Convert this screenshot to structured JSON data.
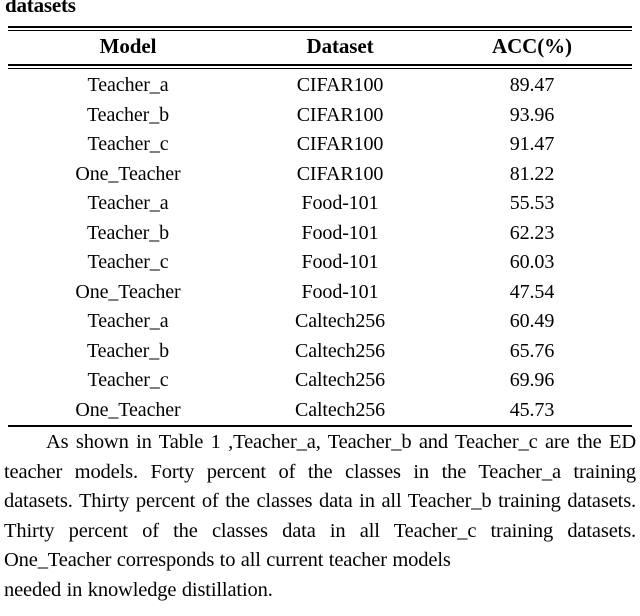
{
  "caption": {
    "clipped_tail": "datasets"
  },
  "table": {
    "columns": [
      "Model",
      "Dataset",
      "ACC(%)"
    ],
    "rows": [
      {
        "model": "Teacher_a",
        "dataset": "CIFAR100",
        "acc": "89.47"
      },
      {
        "model": "Teacher_b",
        "dataset": "CIFAR100",
        "acc": "93.96"
      },
      {
        "model": "Teacher_c",
        "dataset": "CIFAR100",
        "acc": "91.47"
      },
      {
        "model": "One_Teacher",
        "dataset": "CIFAR100",
        "acc": "81.22"
      },
      {
        "model": "Teacher_a",
        "dataset": "Food-101",
        "acc": "55.53"
      },
      {
        "model": "Teacher_b",
        "dataset": "Food-101",
        "acc": "62.23"
      },
      {
        "model": "Teacher_c",
        "dataset": "Food-101",
        "acc": "60.03"
      },
      {
        "model": "One_Teacher",
        "dataset": "Food-101",
        "acc": "47.54"
      },
      {
        "model": "Teacher_a",
        "dataset": "Caltech256",
        "acc": "60.49"
      },
      {
        "model": "Teacher_b",
        "dataset": "Caltech256",
        "acc": "65.76"
      },
      {
        "model": "Teacher_c",
        "dataset": "Caltech256",
        "acc": "69.96"
      },
      {
        "model": "One_Teacher",
        "dataset": "Caltech256",
        "acc": "45.73"
      }
    ]
  },
  "paragraph": {
    "main": "As shown in Table 1 ,Teacher_a, Teacher_b and Teacher_c are the ED teacher models. Forty percent of the classes in the Teacher_a training datasets. Thirty percent of the classes data in all Teacher_b training datasets. Thirty percent of the classes data in all Teacher_c training datasets. One_Teacher corresponds to all current teacher models",
    "clipped_last_line": "needed in knowledge distillation."
  },
  "colors": {
    "page_background": "#ffffff",
    "text": "#000000",
    "rule": "#000000"
  }
}
